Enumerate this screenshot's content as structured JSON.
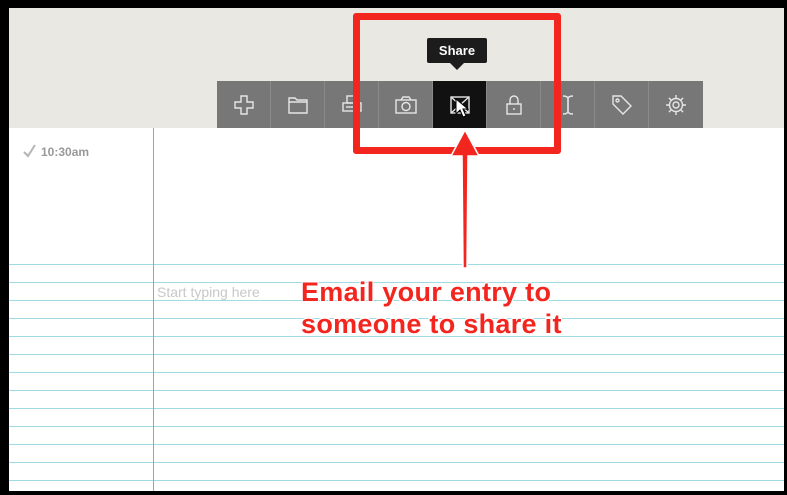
{
  "toolbar": {
    "items": [
      {
        "name": "add",
        "icon": "plus-icon"
      },
      {
        "name": "folder",
        "icon": "folder-icon"
      },
      {
        "name": "print",
        "icon": "printer-icon"
      },
      {
        "name": "photo",
        "icon": "camera-icon"
      },
      {
        "name": "share",
        "icon": "mail-icon",
        "active": true
      },
      {
        "name": "lock",
        "icon": "lock-icon"
      },
      {
        "name": "font",
        "icon": "text-cursor-icon"
      },
      {
        "name": "tag",
        "icon": "tag-icon"
      },
      {
        "name": "settings",
        "icon": "gear-icon"
      }
    ]
  },
  "tooltip": {
    "label": "Share"
  },
  "entry": {
    "time": "10:30am",
    "placeholder": "Start typing here"
  },
  "annotation": {
    "line1": "Email your entry to",
    "line2": "someone to share it"
  },
  "colors": {
    "toolbar_bg": "#777777",
    "active_bg": "#111111",
    "highlight": "#f3261f",
    "rule_line": "#9fdbe3",
    "margin_line": "#e6848a"
  }
}
